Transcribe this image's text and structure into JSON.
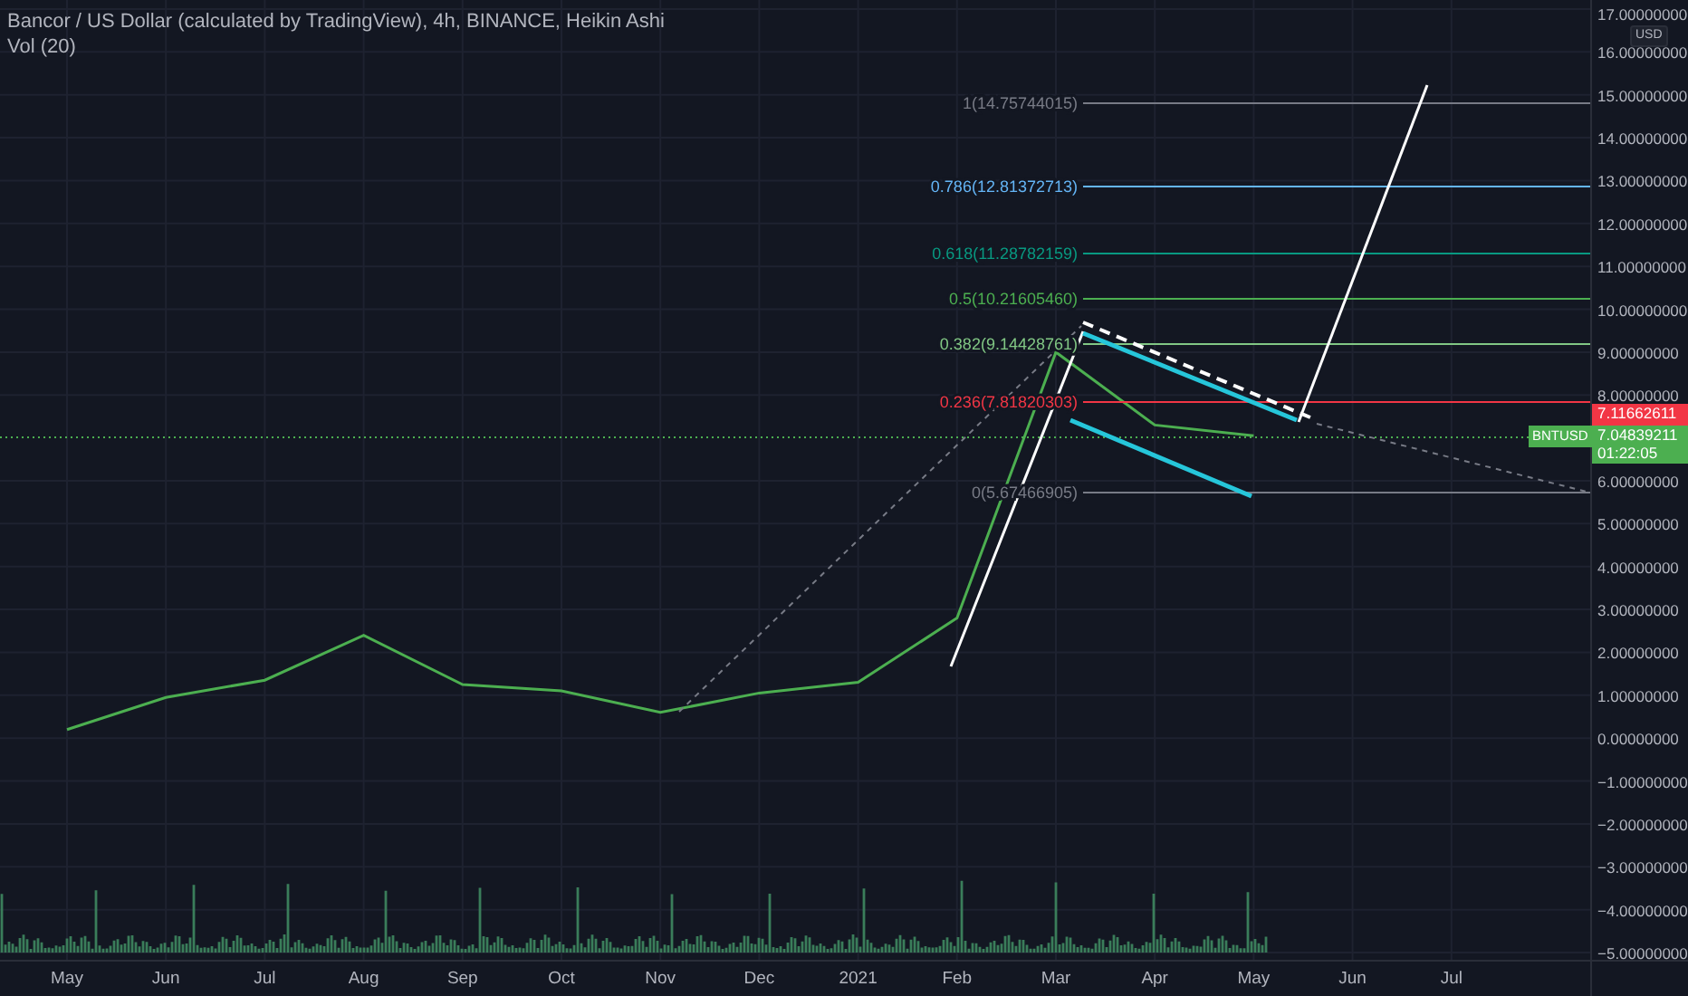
{
  "header": {
    "title": "Bancor / US Dollar (calculated by TradingView), 4h, BINANCE, Heikin Ashi",
    "indicator": "Vol (20)"
  },
  "price_axis": {
    "currency": "USD",
    "last_price": "7.11662611",
    "current_price": "7.04839211",
    "countdown": "01:22:05"
  },
  "fib_levels": [
    {
      "label": "1(14.75744015)",
      "color": "#787b86"
    },
    {
      "label": "0.786(12.81372713)",
      "color": "#64b5f6"
    },
    {
      "label": "0.618(11.28782159)",
      "color": "#089981"
    },
    {
      "label": "0.5(10.21605460)",
      "color": "#4caf50"
    },
    {
      "label": "0.382(9.14428761)",
      "color": "#81c784"
    },
    {
      "label": "0.236(7.81820303)",
      "color": "#f23645"
    },
    {
      "label": "0(5.67466905)",
      "color": "#787b86"
    }
  ],
  "chart_data": {
    "type": "line",
    "grid": true,
    "categories": [
      "May",
      "Jun",
      "Jul",
      "Aug",
      "Sep",
      "Oct",
      "Nov",
      "Dec",
      "2021",
      "Feb",
      "Mar",
      "Apr",
      "May",
      "Jun",
      "Jul"
    ],
    "series": [
      {
        "name": "BNTUSD",
        "color": "#4caf50",
        "values": [
          0.2,
          0.95,
          1.35,
          2.4,
          1.25,
          1.1,
          0.6,
          1.05,
          1.3,
          2.8,
          9.0,
          7.3,
          7.05,
          null,
          null
        ]
      }
    ],
    "ylim": [
      -5,
      17
    ],
    "yticks": [
      {
        "value": 17,
        "label": "17.00000000"
      },
      {
        "value": 16,
        "label": "16.00000000"
      },
      {
        "value": 15,
        "label": "15.00000000"
      },
      {
        "value": 14,
        "label": "14.00000000"
      },
      {
        "value": 13,
        "label": "13.00000000"
      },
      {
        "value": 12,
        "label": "12.00000000"
      },
      {
        "value": 11,
        "label": "11.00000000"
      },
      {
        "value": 10,
        "label": "10.00000000"
      },
      {
        "value": 9,
        "label": "9.00000000"
      },
      {
        "value": 8,
        "label": "8.00000000"
      },
      {
        "value": 6,
        "label": "6.00000000"
      },
      {
        "value": 5,
        "label": "5.00000000"
      },
      {
        "value": 4,
        "label": "4.00000000"
      },
      {
        "value": 3,
        "label": "3.00000000"
      },
      {
        "value": 2,
        "label": "2.00000000"
      },
      {
        "value": 1,
        "label": "1.00000000"
      },
      {
        "value": 0,
        "label": "0.00000000"
      },
      {
        "value": -1,
        "label": "−1.00000000"
      },
      {
        "value": -2,
        "label": "−2.00000000"
      },
      {
        "value": -3,
        "label": "−3.00000000"
      },
      {
        "value": -4,
        "label": "−4.00000000"
      },
      {
        "value": -5,
        "label": "−5.00000000"
      }
    ]
  }
}
